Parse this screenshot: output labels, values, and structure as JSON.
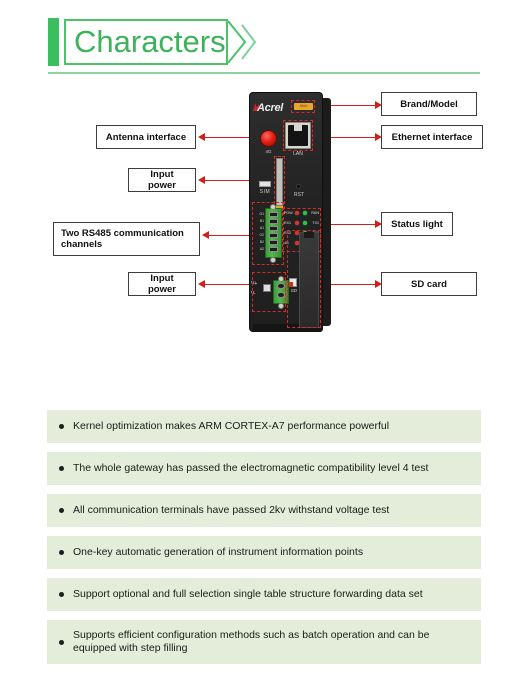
{
  "header": {
    "title": "Characters"
  },
  "diagram": {
    "device": {
      "brand": "Acrel",
      "model_badge": "ANet",
      "antenna_label": "4G",
      "lan_label": "LAN",
      "sim_label": "SIM",
      "rst_label": "RST",
      "sd_label": "SD",
      "power_label_plus": "V+",
      "power_label_minus": "V-",
      "rs485_pins": [
        "G1",
        "B1",
        "A1",
        "G2",
        "B2",
        "A2"
      ],
      "leds": [
        {
          "left_name": "POW",
          "left_color": "#d6352b",
          "right_name": "RUN",
          "right_color": "#2fc049"
        },
        {
          "left_name": "RX1",
          "left_color": "#d6352b",
          "right_name": "TX1",
          "right_color": "#2fc049"
        },
        {
          "left_name": "RX2",
          "left_color": "#d6352b",
          "right_name": "TX2",
          "right_color": "#2fc049"
        },
        {
          "left_name": "4G",
          "left_color": "#d6352b",
          "right_name": "SD",
          "right_color": "#2fc049"
        }
      ]
    },
    "callouts": {
      "brand_model": "Brand/Model",
      "ethernet_interface": "Ethernet interface",
      "antenna_interface": "Antenna interface",
      "input_power_top": "Input power",
      "rs485_channels": "Two RS485 communication channels",
      "status_light": "Status light",
      "input_power_bottom": "Input power",
      "sd_card": "SD card"
    }
  },
  "features": [
    "Kernel optimization makes ARM CORTEX-A7 performance powerful",
    "The whole gateway has passed the electromagnetic compatibility level 4 test",
    "All communication terminals have passed 2kv withstand voltage test",
    "One-key automatic generation of instrument information points",
    "Support optional and full selection single table structure forwarding data set",
    "Supports efficient configuration methods such as batch operation and can be equipped with step filling"
  ],
  "colors": {
    "brand_green": "#3cb35b",
    "accent_bar": "#3bbf5e",
    "arrow_red": "#d1201a",
    "bullet_bg": "#e4edd9",
    "device_body": "#262626",
    "terminal_green": "#54b84c"
  }
}
